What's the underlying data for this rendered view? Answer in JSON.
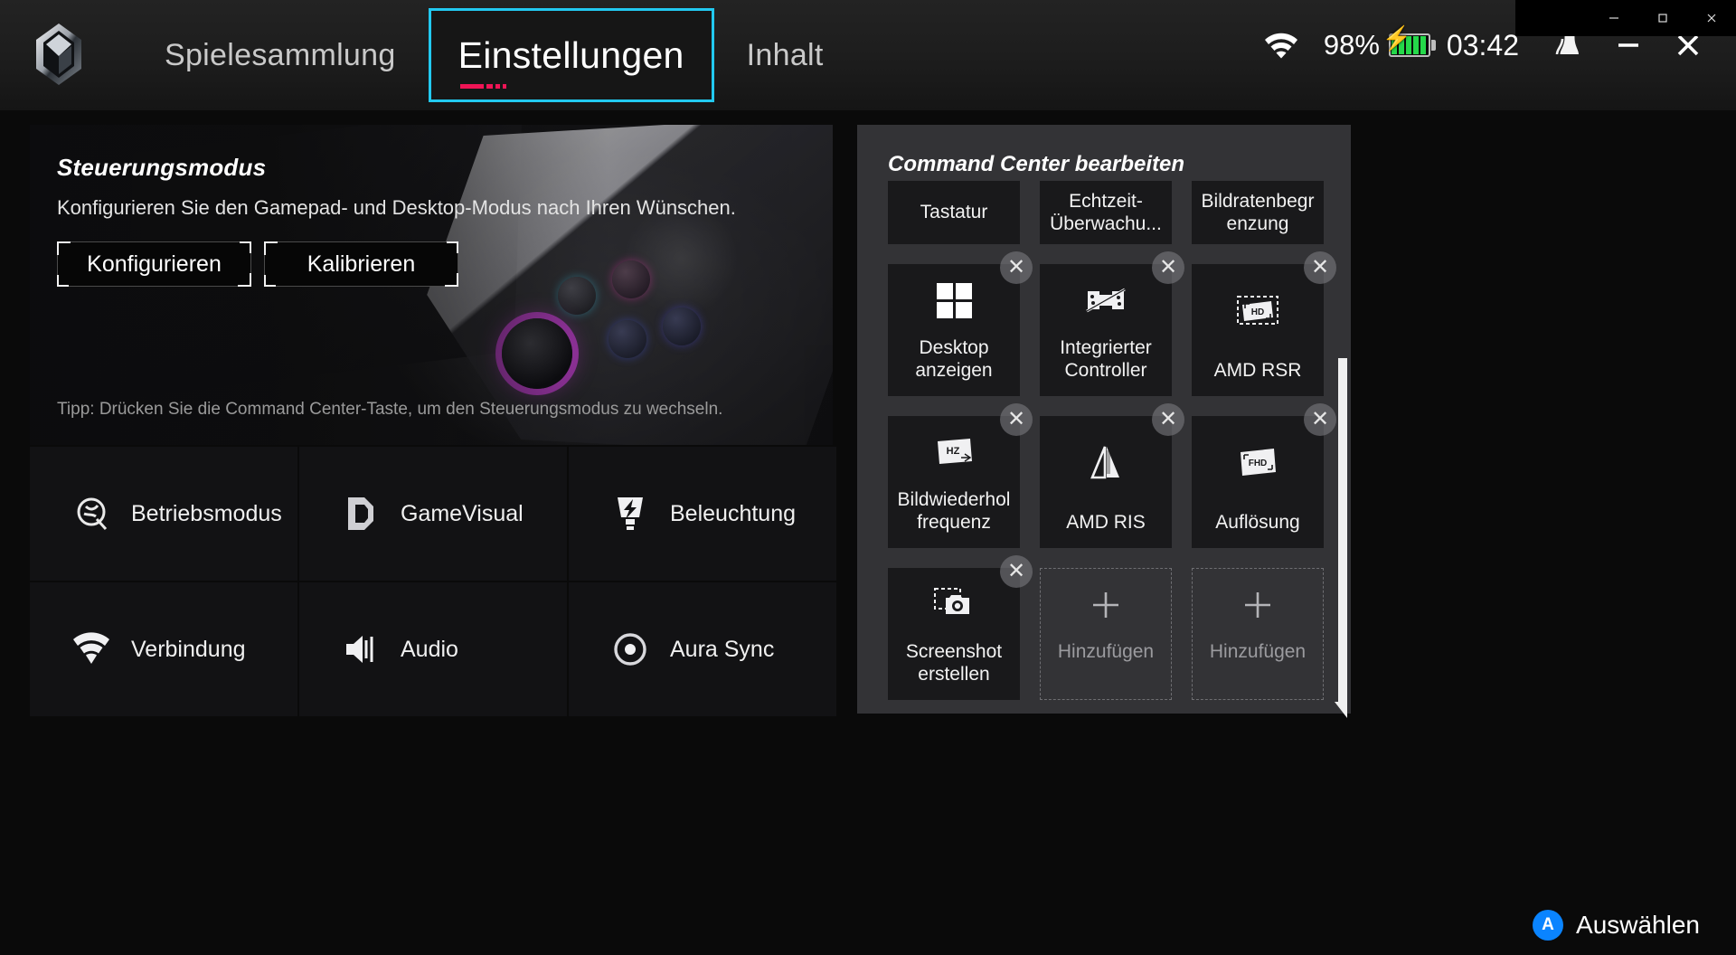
{
  "window": {
    "controls": [
      {
        "name": "minimize",
        "glyph": "minimize-icon"
      },
      {
        "name": "maximize",
        "glyph": "maximize-icon"
      },
      {
        "name": "close",
        "glyph": "close-icon"
      }
    ]
  },
  "header": {
    "logo_name": "armoury-crate-logo",
    "tabs": [
      {
        "label": "Spielesammlung",
        "active": false
      },
      {
        "label": "Einstellungen",
        "active": true
      },
      {
        "label": "Inhalt",
        "active": false
      }
    ],
    "status": {
      "wifi_icon": "wifi-icon",
      "battery_percent": "98%",
      "battery_icon": "battery-charging-icon",
      "clock": "03:42",
      "notification_icon": "bell-icon",
      "minimize_label": "—",
      "close_label": "✕"
    }
  },
  "control_mode": {
    "title": "Steuerungsmodus",
    "description": "Konfigurieren Sie den Gamepad- und Desktop-Modus nach Ihren Wünschen.",
    "buttons": [
      {
        "label": "Konfigurieren"
      },
      {
        "label": "Kalibrieren"
      }
    ],
    "tip": "Tipp: Drücken Sie die Command Center-Taste, um den Steuerungsmodus zu wechseln."
  },
  "settings_tiles": [
    {
      "label": "Betriebsmodus",
      "icon": "performance-mode-icon"
    },
    {
      "label": "GameVisual",
      "icon": "gamevisual-icon"
    },
    {
      "label": "Beleuchtung",
      "icon": "lighting-icon"
    },
    {
      "label": "Verbindung",
      "icon": "wifi-icon"
    },
    {
      "label": "Audio",
      "icon": "speaker-icon"
    },
    {
      "label": "Aura Sync",
      "icon": "aura-sync-icon"
    }
  ],
  "command_center": {
    "title": "Command Center bearbeiten",
    "row_top": [
      {
        "label": "Tastatur",
        "icon": "keyboard-icon",
        "removable": false
      },
      {
        "label": "Echtzeit-\nÜberwachu...",
        "icon": "realtime-monitor-icon",
        "removable": false
      },
      {
        "label": "Bildratenbegr\nenzung",
        "icon": "fps-limit-icon",
        "removable": false
      }
    ],
    "tiles": [
      {
        "label": "Desktop\nanzeigen",
        "icon": "windows-icon",
        "removable": true,
        "placeholder": false
      },
      {
        "label": "Integrierter\nController",
        "icon": "controller-disabled-icon",
        "removable": true,
        "placeholder": false
      },
      {
        "label": "AMD RSR",
        "icon": "hd-upscale-icon",
        "removable": true,
        "placeholder": false
      },
      {
        "label": "Bildwiederhol\nfrequenz",
        "icon": "refresh-rate-hz-icon",
        "removable": true,
        "placeholder": false
      },
      {
        "label": "AMD RIS",
        "icon": "sharpening-icon",
        "removable": true,
        "placeholder": false
      },
      {
        "label": "Auflösung",
        "icon": "fhd-resolution-icon",
        "removable": true,
        "placeholder": false
      },
      {
        "label": "Screenshot\nerstellen",
        "icon": "screenshot-camera-icon",
        "removable": true,
        "placeholder": false
      },
      {
        "label": "Hinzufügen",
        "icon": "plus-icon",
        "removable": false,
        "placeholder": true
      },
      {
        "label": "Hinzufügen",
        "icon": "plus-icon",
        "removable": false,
        "placeholder": true
      }
    ],
    "close_glyph": "✕"
  },
  "footer": {
    "button_badge": "A",
    "label": "Auswählen"
  },
  "colors": {
    "accent_cyan": "#22c9f0",
    "accent_magenta": "#ef1455",
    "battery_green": "#25d94a",
    "badge_blue": "#0a84ff"
  }
}
